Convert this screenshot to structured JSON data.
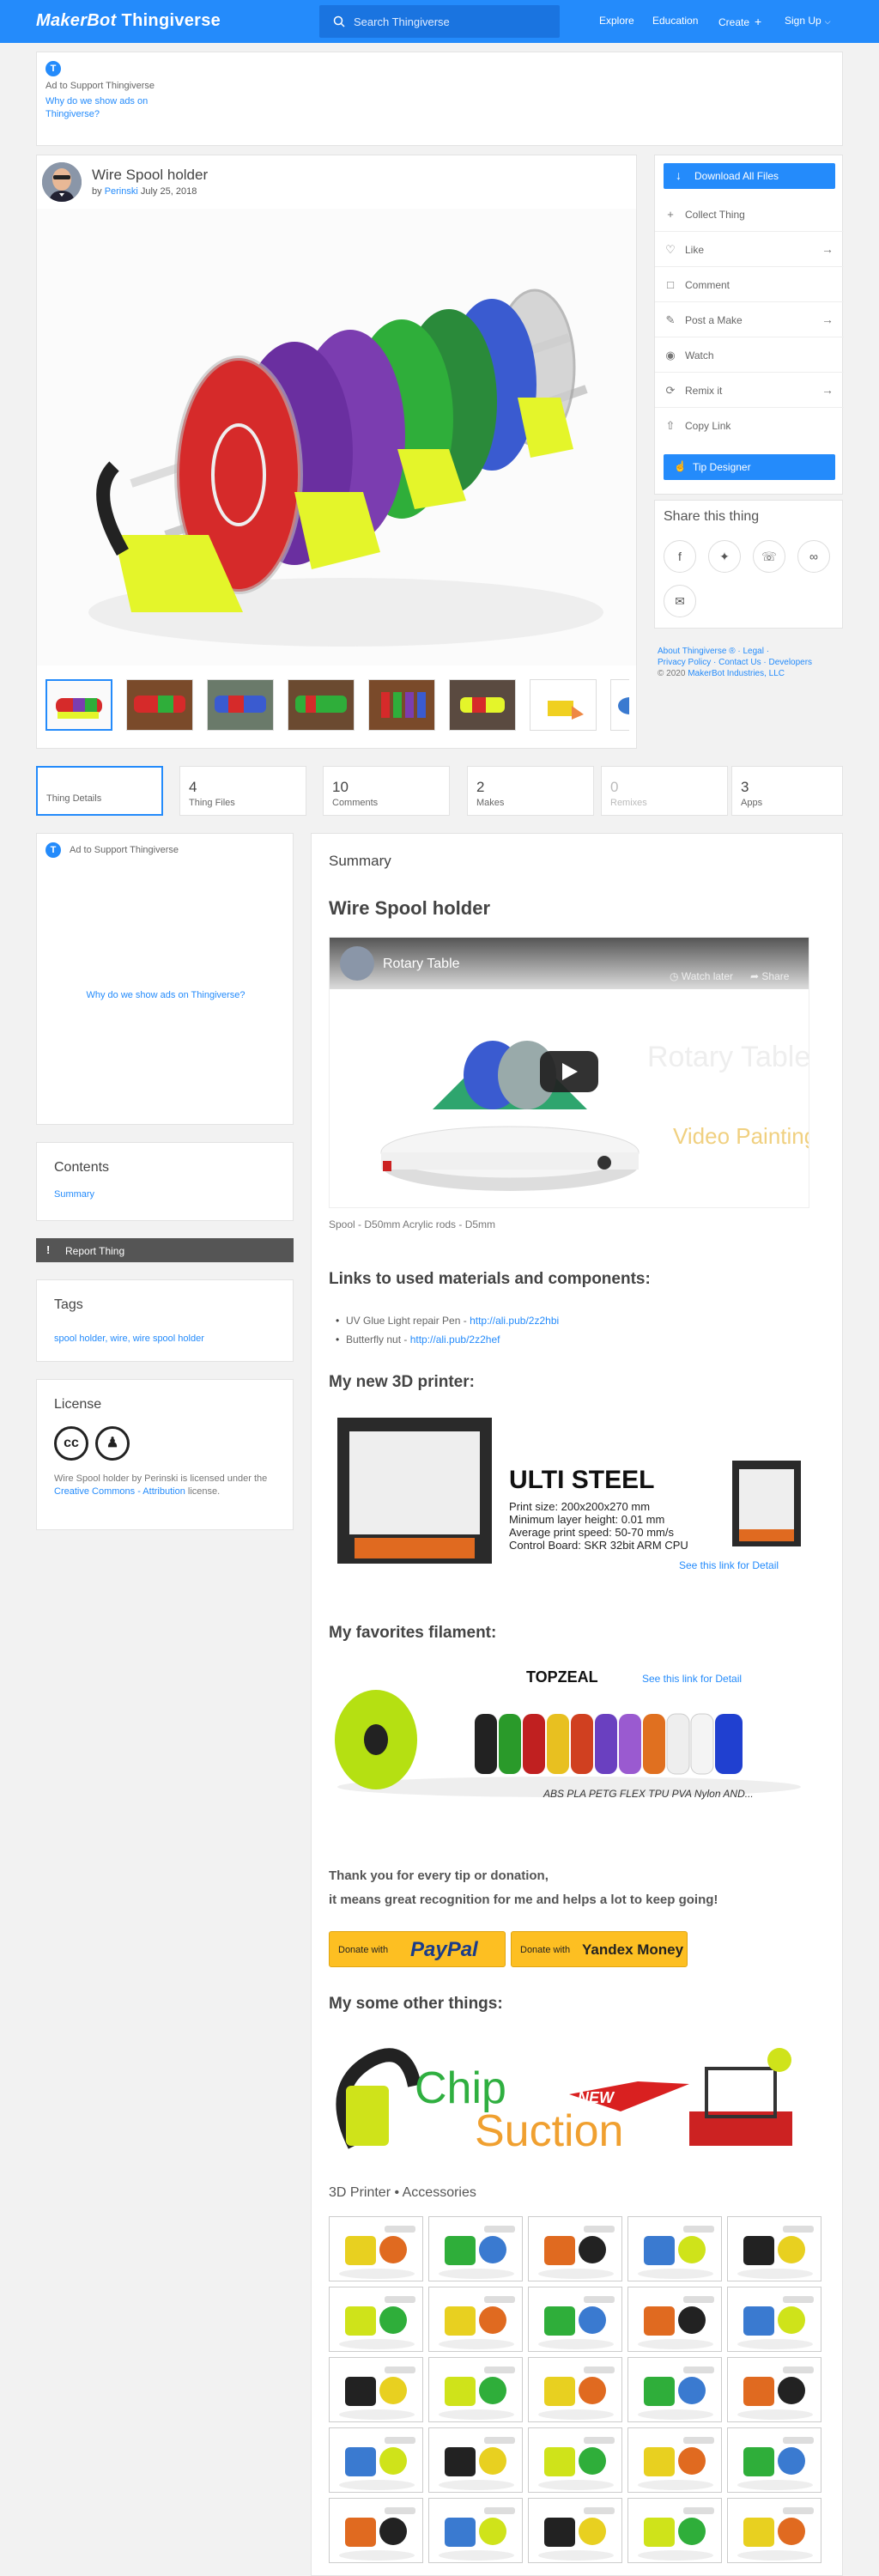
{
  "header": {
    "logo_brand": "MakerBot",
    "logo_product": "Thingiverse",
    "search_placeholder": "Search Thingiverse",
    "nav": {
      "explore": "Explore",
      "education": "Education",
      "create": "Create",
      "signup": "Sign Up"
    },
    "accent": "#248bfb"
  },
  "ad_top": {
    "badge": "T",
    "label": "Ad to Support Thingiverse",
    "why": "Why do we show ads on Thingiverse?"
  },
  "thing": {
    "title": "Wire Spool holder",
    "by": "by",
    "author": "Perinski",
    "date": "July 25, 2018"
  },
  "actions": {
    "download": "Download All Files",
    "items": [
      {
        "label": "Collect Thing",
        "icon": "plus-icon"
      },
      {
        "label": "Like",
        "icon": "heart-icon"
      },
      {
        "label": "Comment",
        "icon": "comment-icon"
      },
      {
        "label": "Post a Make",
        "icon": "make-icon"
      },
      {
        "label": "Watch",
        "icon": "eye-icon"
      },
      {
        "label": "Remix it",
        "icon": "remix-icon"
      },
      {
        "label": "Copy Link",
        "icon": "share-icon"
      }
    ],
    "tip": "Tip Designer"
  },
  "share": {
    "title": "Share this thing"
  },
  "legal": {
    "line1": "About Thingiverse ® · Legal ·",
    "line2": "Privacy Policy · Contact Us · Developers",
    "copyright": "© 2020",
    "company": "MakerBot Industries, LLC"
  },
  "tabs": [
    {
      "num": "",
      "label": "Thing Details"
    },
    {
      "num": "4",
      "label": "Thing Files"
    },
    {
      "num": "10",
      "label": "Comments"
    },
    {
      "num": "2",
      "label": "Makes"
    },
    {
      "num": "0",
      "label": "Remixes"
    },
    {
      "num": "3",
      "label": "Apps"
    }
  ],
  "sidebar": {
    "ad_label": "Ad to Support Thingiverse",
    "ad_why": "Why do we show ads on Thingiverse?",
    "contents_title": "Contents",
    "contents_link": "Summary",
    "report": "Report Thing",
    "tags_title": "Tags",
    "tags": "spool holder, wire, wire spool holder",
    "license_title": "License",
    "license_pre": "Wire Spool holder by Perinski is licensed under the",
    "license_link": "Creative Commons - Attribution",
    "license_post": "license."
  },
  "main": {
    "summary": "Summary",
    "h1": "Wire Spool holder",
    "video_title": "Rotary Table",
    "video_later": "Watch later",
    "video_share": "Share",
    "video_art": "Rotary Table",
    "video_art2": "Video Painting Photo",
    "caption": "Spool - D50mm Acrylic rods - D5mm",
    "h_links": "Links to used materials and components:",
    "links": [
      {
        "label": "UV Glue Light repair Pen - ",
        "url": "http://ali.pub/2z2hbi"
      },
      {
        "label": "Butterfly nut - ",
        "url": "http://ali.pub/2z2hef"
      }
    ],
    "h_printer": "My new 3D printer:",
    "printer": {
      "name": "ULTI STEEL",
      "specs": [
        "Print size: 200x200x270 mm",
        "Minimum layer height: 0.01 mm",
        "Average print speed: 50-70 mm/s",
        "Control Board: SKR 32bit ARM CPU"
      ],
      "link": "See this link for Detail"
    },
    "h_filament": "My favorites filament:",
    "filament": {
      "brand": "TOPZEAL",
      "link": "See this link for Detail",
      "types": "ABS PLA PETG FLEX TPU PVA Nylon AND..."
    },
    "thanks1": "Thank you for every tip or donation,",
    "thanks2": "it means great recognition for me and helps a lot to keep going!",
    "donate1": {
      "label": "Donate with",
      "brand": "PayPal"
    },
    "donate2": {
      "label": "Donate with",
      "brand": "Yandex Money"
    },
    "h_other": "My some other things:",
    "other_banner": {
      "chip": "Chip",
      "suction": "Suction",
      "new": "NEW"
    },
    "accessories": "3D Printer • Accessories"
  }
}
